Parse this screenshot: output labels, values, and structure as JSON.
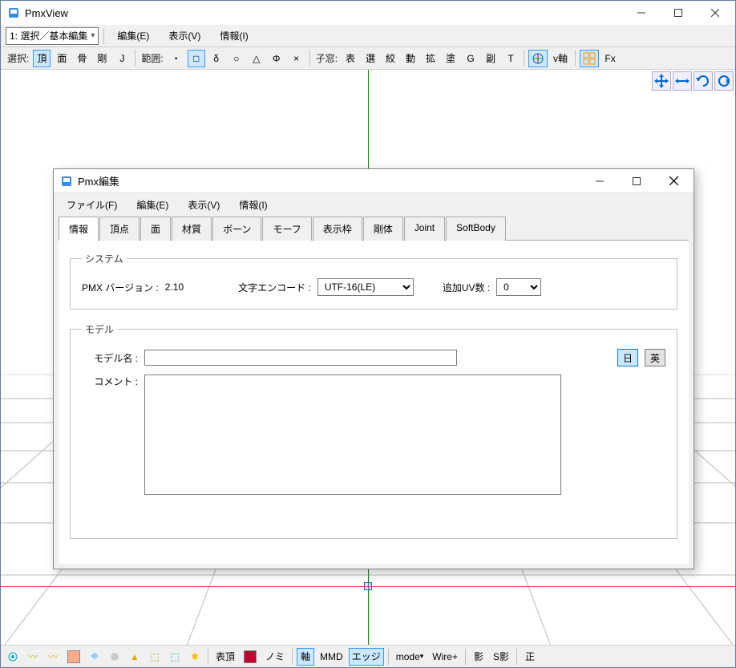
{
  "main": {
    "title": "PmxView",
    "mode_combo": "1: 選択／基本編集",
    "menus": [
      "編集(E)",
      "表示(V)",
      "情報(I)"
    ],
    "toolbar": {
      "select_label": "選択:",
      "sel_modes": [
        "頂",
        "面",
        "骨",
        "剛",
        "J"
      ],
      "range_label": "範囲:",
      "range_dot": "・",
      "shape_sq": "□",
      "shape_delta": "δ",
      "shape_circle": "○",
      "shape_tri": "△",
      "shape_phi": "Φ",
      "shape_x": "×",
      "child_label": "子窓:",
      "childwins": [
        "表",
        "選",
        "絞",
        "動",
        "拡",
        "塗",
        "G",
        "副",
        "T"
      ],
      "vaxis": "v軸",
      "fx": "Fx"
    },
    "status": {
      "surface": "表頂",
      "nomi": "ノミ",
      "axis": "軸",
      "mmd": "MMD",
      "edge": "エッジ",
      "mode": "mode",
      "wire": "Wire+",
      "shadow": "影",
      "sshadow": "S影",
      "normal": "正"
    }
  },
  "dialog": {
    "title": "Pmx編集",
    "menus": [
      "ファイル(F)",
      "編集(E)",
      "表示(V)",
      "情報(I)"
    ],
    "tabs": [
      "情報",
      "頂点",
      "面",
      "材質",
      "ボーン",
      "モーフ",
      "表示枠",
      "剛体",
      "Joint",
      "SoftBody"
    ],
    "system": {
      "legend": "システム",
      "version_label": "PMX バージョン :",
      "version": "2.10",
      "encoding_label": "文字エンコード :",
      "encoding": "UTF-16(LE)",
      "uv_label": "追加UV数 :",
      "uv": "0"
    },
    "model": {
      "legend": "モデル",
      "name_label": "モデル名 :",
      "name": "",
      "jp": "日",
      "en": "英",
      "comment_label": "コメント :",
      "comment": ""
    }
  }
}
